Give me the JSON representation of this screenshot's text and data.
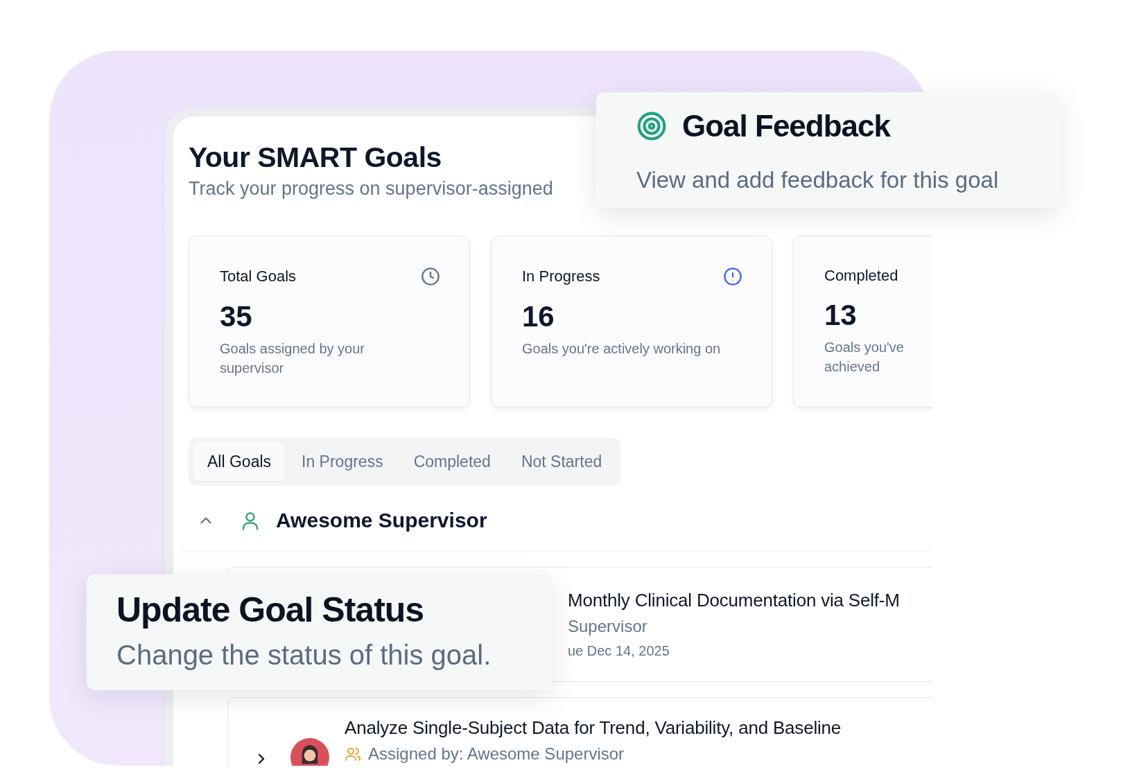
{
  "feedback_callout": {
    "title": "Goal Feedback",
    "subtitle": "View and add feedback for this goal"
  },
  "page": {
    "title": "Your SMART Goals",
    "subtitle": "Track your progress on supervisor-assigned"
  },
  "stats": [
    {
      "label": "Total Goals",
      "value": "35",
      "description": [
        "Goals assigned by your",
        "supervisor"
      ]
    },
    {
      "label": "In Progress",
      "value": "16",
      "description": [
        "Goals you're actively working on"
      ]
    },
    {
      "label": "Completed",
      "value": "13",
      "description": [
        "Goals you've",
        "achieved"
      ]
    }
  ],
  "tabs": [
    {
      "label": "All Goals",
      "selected": true
    },
    {
      "label": "In Progress",
      "selected": false
    },
    {
      "label": "Completed",
      "selected": false
    },
    {
      "label": "Not Started",
      "selected": false
    }
  ],
  "group": {
    "name": "Awesome Supervisor",
    "expanded": true
  },
  "goals": [
    {
      "title": "Monthly Clinical Documentation via Self-M",
      "assigned_by": "Supervisor",
      "due": "ue Dec 14, 2025"
    },
    {
      "title": "Analyze Single-Subject Data for Trend, Variability, and Baseline",
      "assigned_by": "Assigned by: Awesome Supervisor",
      "expanded": false
    }
  ],
  "status_callout": {
    "title": "Update Goal Status",
    "subtitle": "Change the status of this goal."
  }
}
